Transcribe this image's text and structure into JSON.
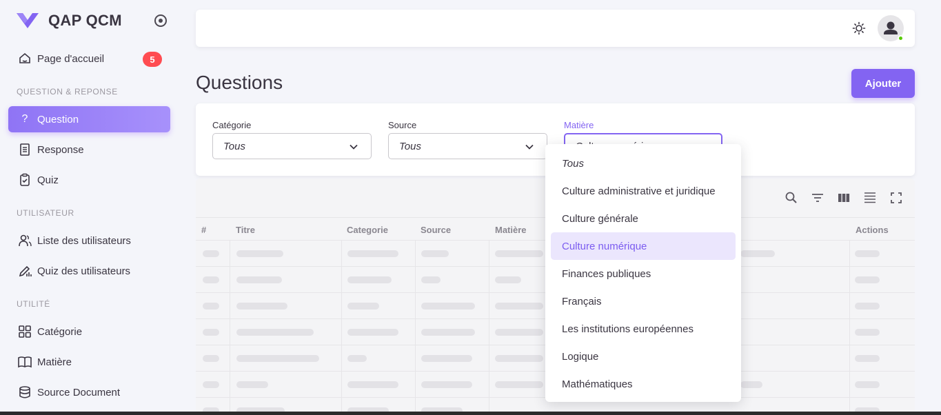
{
  "brand": {
    "name": "QAP QCM"
  },
  "sidebar": {
    "home": {
      "label": "Page d'accueil",
      "badge": "5"
    },
    "section1": "QUESTION & REPONSE",
    "question": "Question",
    "response": "Response",
    "quiz": "Quiz",
    "section2": "UTILISATEUR",
    "users_list": "Liste des utilisateurs",
    "users_quiz": "Quiz des utilisateurs",
    "section3": "UTILITÉ",
    "category": "Catégorie",
    "subject": "Matière",
    "source_doc": "Source Document"
  },
  "page": {
    "title": "Questions",
    "add_button": "Ajouter"
  },
  "filters": {
    "category": {
      "label": "Catégorie",
      "value": "Tous"
    },
    "source": {
      "label": "Source",
      "value": "Tous"
    },
    "subject": {
      "label": "Matière",
      "value": "Culture numérique"
    }
  },
  "table": {
    "headers": [
      "#",
      "Titre",
      "Categorie",
      "Source",
      "Matière",
      "Actions"
    ]
  },
  "dropdown": {
    "options": [
      "Tous",
      "Culture administrative et juridique",
      "Culture générale",
      "Culture numérique",
      "Finances publiques",
      "Français",
      "Les institutions européennes",
      "Logique",
      "Mathématiques"
    ],
    "selected": "Culture numérique"
  },
  "colors": {
    "accent": "#8364f2",
    "badge": "#ff4c51",
    "online": "#56ca00"
  },
  "icons": [
    "home-icon",
    "question-icon",
    "receipt-icon",
    "clipboard-check-icon",
    "users-icon",
    "pencil-chart-icon",
    "grid-icon",
    "book-icon",
    "database-icon",
    "sun-icon",
    "user-avatar-icon",
    "search-icon",
    "filter-icon",
    "columns-icon",
    "density-icon",
    "fullscreen-icon",
    "chevron-down-icon"
  ]
}
